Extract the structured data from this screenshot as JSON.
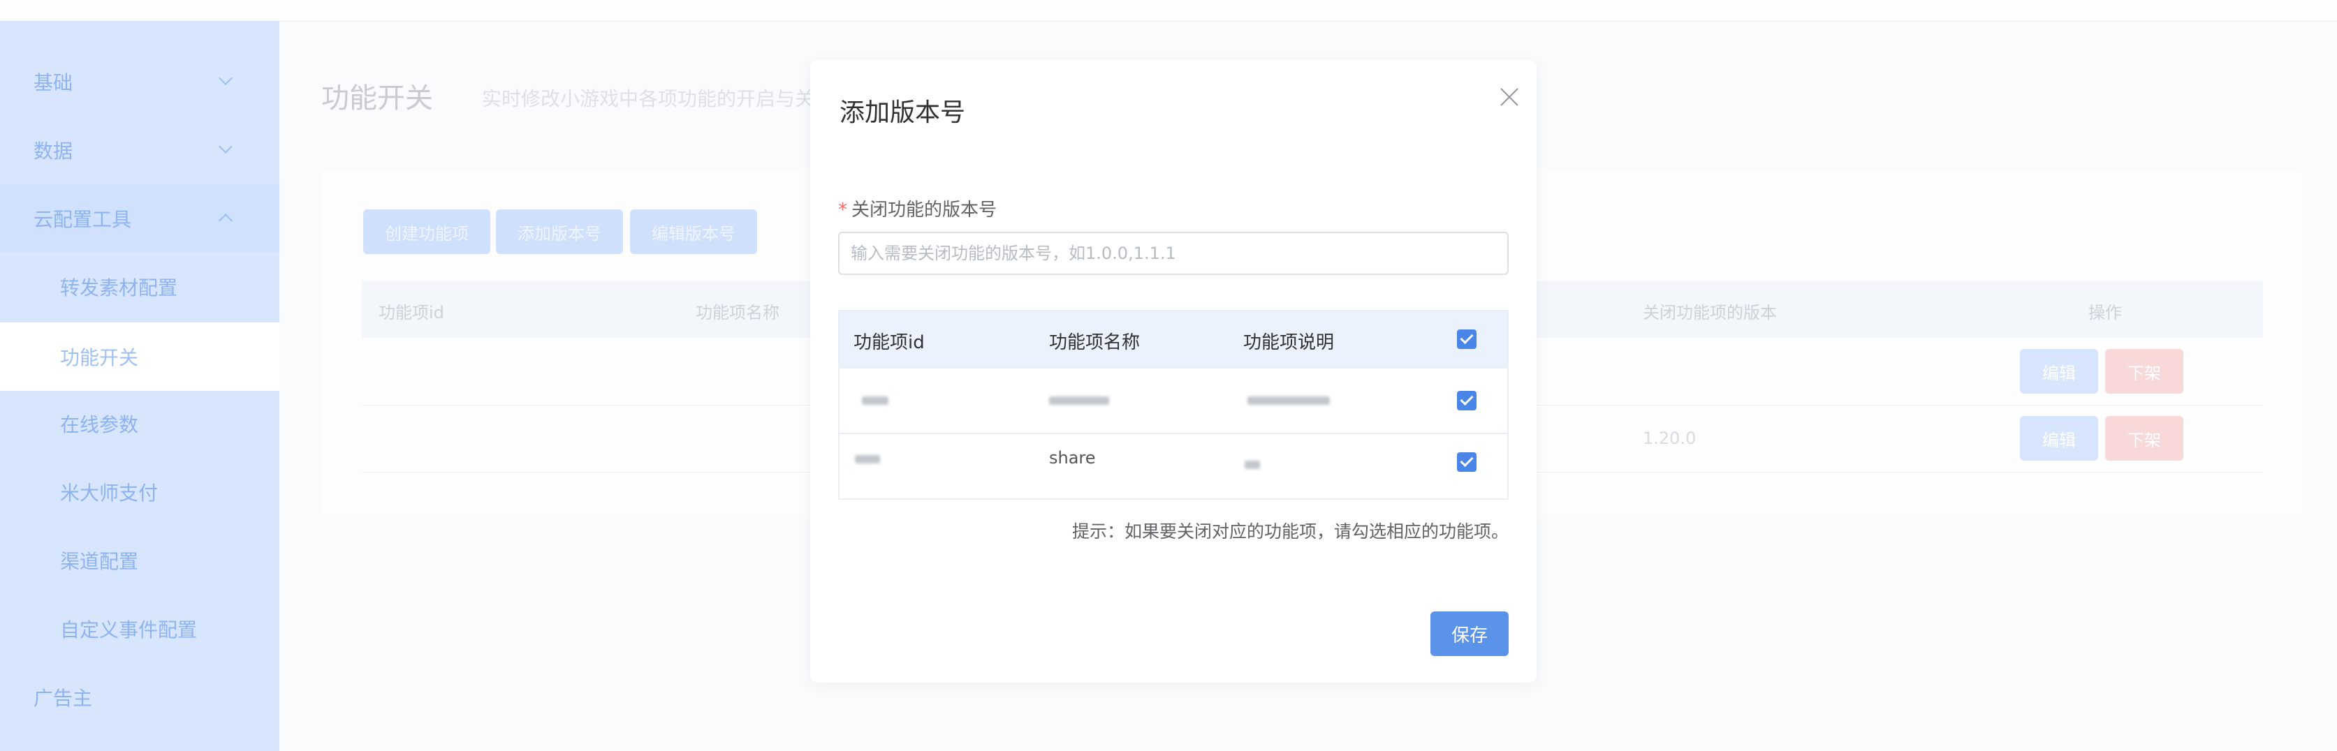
{
  "sidebar": {
    "items": [
      {
        "label": "基础"
      },
      {
        "label": "数据"
      },
      {
        "label": "云配置工具"
      },
      {
        "label": "转发素材配置"
      },
      {
        "label": "功能开关"
      },
      {
        "label": "在线参数"
      },
      {
        "label": "米大师支付"
      },
      {
        "label": "渠道配置"
      },
      {
        "label": "自定义事件配置"
      },
      {
        "label": "广告主"
      }
    ]
  },
  "page": {
    "title": "功能开关",
    "subtitle": "实时修改小游戏中各项功能的开启与关",
    "toolbar": {
      "create_label": "创建功能项",
      "add_version_label": "添加版本号",
      "edit_version_label": "编辑版本号"
    },
    "table": {
      "headers": {
        "id": "功能项id",
        "name": "功能项名称",
        "close_version": "关闭功能项的版本",
        "actions": "操作"
      },
      "rows": [
        {
          "close_version": "",
          "edit": "编辑",
          "off": "下架"
        },
        {
          "close_version": "1.20.0",
          "edit": "编辑",
          "off": "下架"
        }
      ]
    }
  },
  "modal": {
    "title": "添加版本号",
    "field_label": "关闭功能的版本号",
    "required_mark": "*",
    "input_placeholder": "输入需要关闭功能的版本号，如1.0.0,1.1.1",
    "input_value": "",
    "table": {
      "headers": {
        "id": "功能项id",
        "name": "功能项名称",
        "desc": "功能项说明"
      },
      "header_checked": true,
      "rows": [
        {
          "id": "",
          "name": "",
          "desc": "",
          "checked": true
        },
        {
          "id": "",
          "name": "share",
          "desc": "",
          "checked": true
        }
      ]
    },
    "hint": "提示：如果要关闭对应的功能项，请勾选相应的功能项。",
    "save_label": "保存"
  },
  "colors": {
    "primary": "#5b92ea",
    "checkbox": "#4a86e8",
    "required": "#f56c6c",
    "sidebar_bg": "#d7e6fd"
  },
  "icons": [
    "chevron-down-icon",
    "chevron-up-icon",
    "close-icon",
    "checkbox-checked-icon"
  ]
}
